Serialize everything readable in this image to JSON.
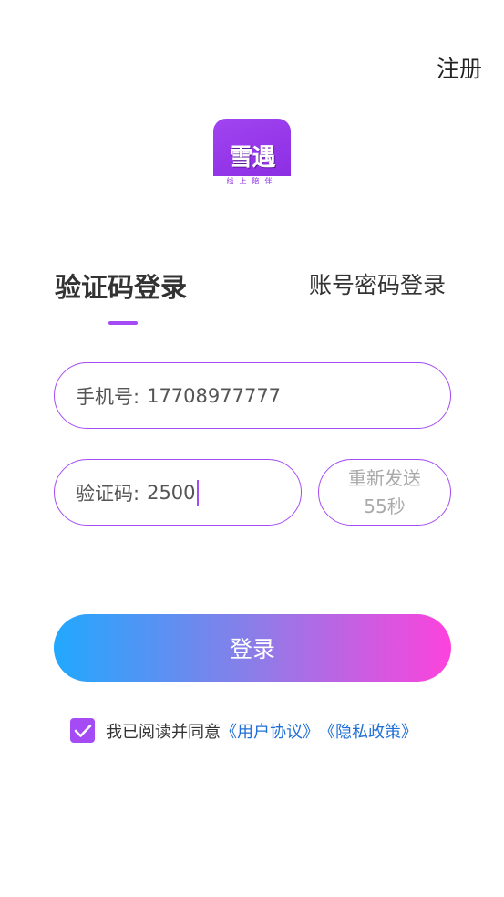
{
  "header": {
    "register_label": "注册"
  },
  "logo": {
    "main_text": "雪遇",
    "sub_text": "线上陪伴"
  },
  "tabs": {
    "sms_login": "验证码登录",
    "password_login": "账号密码登录"
  },
  "form": {
    "phone_label": "手机号:",
    "phone_value": "17708977777",
    "code_label": "验证码:",
    "code_value": "2500",
    "resend_line1": "重新发送",
    "resend_line2": "55秒"
  },
  "login_button_label": "登录",
  "agreement": {
    "checked": true,
    "prefix": "我已阅读并同意",
    "user_agreement": "《用户协议》",
    "privacy_policy": "《隐私政策》"
  },
  "colors": {
    "accent": "#a54bf5",
    "link": "#1f6fd6",
    "gradient_start": "#21a8fe",
    "gradient_end": "#fd43dc"
  }
}
